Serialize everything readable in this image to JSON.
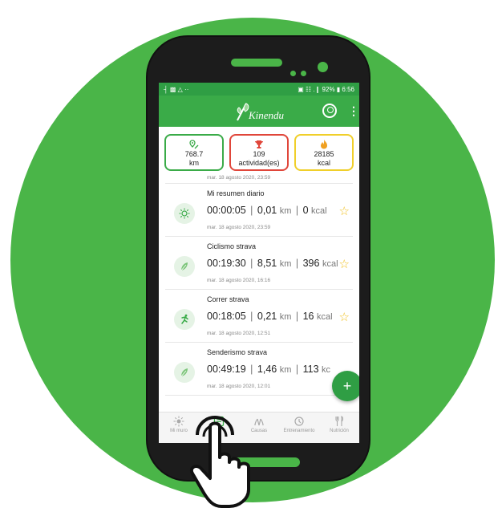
{
  "colors": {
    "brand_green": "#3aab48",
    "background_circle": "#4ab548",
    "star": "#f0c020"
  },
  "status_bar": {
    "left_icons": "┤ ▩ △ ··",
    "right_text": "▣ ☷ .❙ 92% ▮ 6:56"
  },
  "app_bar": {
    "logo_text": "Kinendu",
    "logo_icon": "leaf-k-logo-icon",
    "account_icon": "account-icon",
    "menu_icon": "more-vert-icon"
  },
  "stats": [
    {
      "icon": "distance-pin-icon",
      "value": "768.7",
      "unit": "km"
    },
    {
      "icon": "trophy-icon",
      "value": "109",
      "unit": "actividad(es)"
    },
    {
      "icon": "flame-icon",
      "value": "28185",
      "unit": "kcal"
    }
  ],
  "list": {
    "top_partial_date": "mar. 18 agosto 2020, 23:59",
    "items": [
      {
        "icon": "sun-icon",
        "name": "Mi resumen diario",
        "time": "00:00:05",
        "distance": "0,01",
        "distance_unit": "km",
        "kcal": "0",
        "kcal_unit": "kcal",
        "date": "mar. 18 agosto 2020, 23:59",
        "star": "☆"
      },
      {
        "icon": "leaf-icon",
        "name": "Ciclismo strava",
        "time": "00:19:30",
        "distance": "8,51",
        "distance_unit": "km",
        "kcal": "396",
        "kcal_unit": "kcal",
        "date": "mar. 18 agosto 2020, 16:16",
        "star": "☆"
      },
      {
        "icon": "running-icon",
        "name": "Correr strava",
        "time": "00:18:05",
        "distance": "0,21",
        "distance_unit": "km",
        "kcal": "16",
        "kcal_unit": "kcal",
        "date": "mar. 18 agosto 2020, 12:51",
        "star": "☆"
      },
      {
        "icon": "leaf-icon",
        "name": "Senderismo strava",
        "time": "00:49:19",
        "distance": "1,46",
        "distance_unit": "km",
        "kcal": "113",
        "kcal_unit": "kc",
        "date": "mar. 18 agosto 2020, 12:01",
        "star": ""
      }
    ],
    "separator": "|"
  },
  "fab": {
    "label": "+"
  },
  "bottom_nav": [
    {
      "icon": "sun-icon",
      "label": "Mi muro"
    },
    {
      "icon": "list-icon",
      "label": ""
    },
    {
      "icon": "hands-icon",
      "label": "Causas"
    },
    {
      "icon": "training-icon",
      "label": "Entrenamiento"
    },
    {
      "icon": "cutlery-icon",
      "label": "Nutrición"
    }
  ]
}
